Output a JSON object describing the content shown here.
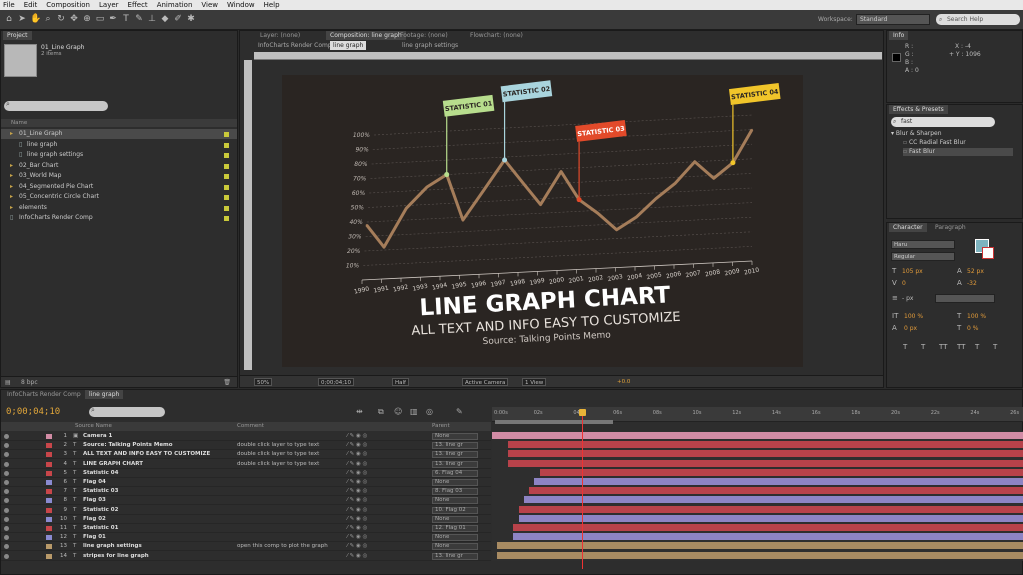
{
  "menu": [
    "File",
    "Edit",
    "Composition",
    "Layer",
    "Effect",
    "Animation",
    "View",
    "Window",
    "Help"
  ],
  "toolbar": {
    "workspace_label": "Workspace:",
    "workspace_value": "Standard",
    "search_placeholder": "Search Help"
  },
  "project": {
    "tab": "Project",
    "name": "01_Line Graph",
    "subtitle": "2 items",
    "col_name": "Name",
    "footer_bpc": "8 bpc",
    "items": [
      {
        "label": "01_Line Graph",
        "type": "folder",
        "sub": false,
        "sel": true
      },
      {
        "label": "line graph",
        "type": "comp",
        "sub": true
      },
      {
        "label": "line graph settings",
        "type": "comp",
        "sub": true
      },
      {
        "label": "02_Bar Chart",
        "type": "folder",
        "sub": false
      },
      {
        "label": "03_World Map",
        "type": "folder",
        "sub": false
      },
      {
        "label": "04_Segmented Pie Chart",
        "type": "folder",
        "sub": false
      },
      {
        "label": "05_Concentric Circle Chart",
        "type": "folder",
        "sub": false
      },
      {
        "label": "elements",
        "type": "folder",
        "sub": false
      },
      {
        "label": "InfoCharts Render Comp",
        "type": "comp",
        "sub": false
      }
    ]
  },
  "viewer": {
    "tabs": [
      "Layer: (none)",
      "Composition: line graph",
      "Footage: (none)",
      "Flowchart: (none)"
    ],
    "sub_tabs": [
      "InfoCharts Render Comp",
      "line graph",
      "line graph settings"
    ],
    "zoom": "50%",
    "timecode": "0;00;04;10",
    "resolution": "Half",
    "camera": "Active Camera",
    "views": "1 View",
    "exposure": "+0.0"
  },
  "chart_data": {
    "type": "line",
    "x": [
      "1990",
      "1991",
      "1992",
      "1993",
      "1994",
      "1995",
      "1996",
      "1997",
      "1998",
      "1999",
      "2000",
      "2001",
      "2002",
      "2003",
      "2004",
      "2005",
      "2006",
      "2007",
      "2008",
      "2009",
      "2010"
    ],
    "y_ticks": [
      "100%",
      "90%",
      "80%",
      "70%",
      "60%",
      "50%",
      "40%",
      "30%",
      "20%",
      "10%"
    ],
    "ylim": [
      0,
      100
    ],
    "series": [
      {
        "values": [
          38,
          22,
          48,
          62,
          70,
          38,
          58,
          78,
          62,
          46,
          68,
          48,
          38,
          26,
          34,
          46,
          56,
          70,
          58,
          68,
          90
        ]
      }
    ],
    "flags": [
      {
        "label": "STATISTIC 01",
        "x_index": 4,
        "color": "#b7dd8d"
      },
      {
        "label": "STATISTIC 02",
        "x_index": 7,
        "color": "#a9d4dd"
      },
      {
        "label": "STATISTIC 03",
        "x_index": 11,
        "color": "#e24a2a"
      },
      {
        "label": "STATISTIC 04",
        "x_index": 19,
        "color": "#f1c52a"
      }
    ],
    "title": "LINE GRAPH CHART",
    "subtitle": "ALL TEXT AND INFO EASY TO CUSTOMIZE",
    "source": "Source: Talking Points Memo",
    "line_color": "#a57d5a",
    "grid": true
  },
  "info": {
    "tab": "Info",
    "x": "X : -4",
    "y": "+ Y : 1096",
    "r": "R :",
    "g": "G :",
    "b": "B :",
    "a": "A : 0"
  },
  "effects": {
    "tabs": [
      "Effects & Presets"
    ],
    "search": "fast",
    "category": "Blur & Sharpen",
    "items": [
      "CC Radial Fast Blur",
      "Fast Blur"
    ]
  },
  "character": {
    "tabs": [
      "Character",
      "Paragraph"
    ],
    "font": "Haru",
    "style": "Regular",
    "size": "105 px",
    "leading": "52 px",
    "tracking": "0",
    "kerning": "-32",
    "stroke": "- px",
    "vscale": "100 %",
    "hscale": "100 %",
    "baseline": "0 px",
    "tsume": "0 %",
    "styles": [
      "T",
      "T",
      "TT",
      "TT",
      "T",
      "T"
    ]
  },
  "timeline": {
    "tabs": [
      "InfoCharts Render Comp",
      "line graph"
    ],
    "time": "0;00;04;10",
    "headers": {
      "name": "Source Name",
      "comment": "Comment",
      "parent": "Parent"
    },
    "ticks": [
      "0:00s",
      "02s",
      "04s",
      "06s",
      "08s",
      "10s",
      "12s",
      "14s",
      "16s",
      "18s",
      "20s",
      "22s",
      "24s",
      "26s"
    ],
    "layers": [
      {
        "num": "1",
        "name": "Camera 1",
        "comment": "",
        "parent": "None",
        "color": "#d28ca5"
      },
      {
        "num": "2",
        "name": "Source: Talking Points Memo",
        "comment": "double click layer to type text",
        "parent": "13. line gr",
        "color": "#c8464a"
      },
      {
        "num": "3",
        "name": "ALL TEXT AND INFO EASY TO CUSTOMIZE",
        "comment": "double click layer to type text",
        "parent": "13. line gr",
        "color": "#c8464a"
      },
      {
        "num": "4",
        "name": "LINE GRAPH CHART",
        "comment": "double click layer to type text",
        "parent": "13. line gr",
        "color": "#c8464a"
      },
      {
        "num": "5",
        "name": "Statistic 04",
        "comment": "",
        "parent": "6. Flag 04",
        "color": "#c8464a"
      },
      {
        "num": "6",
        "name": "Flag 04",
        "comment": "",
        "parent": "None",
        "color": "#8a8ad0"
      },
      {
        "num": "7",
        "name": "Statistic 03",
        "comment": "",
        "parent": "8. Flag 03",
        "color": "#c8464a"
      },
      {
        "num": "8",
        "name": "Flag 03",
        "comment": "",
        "parent": "None",
        "color": "#8a8ad0"
      },
      {
        "num": "9",
        "name": "Statistic 02",
        "comment": "",
        "parent": "10. Flag 02",
        "color": "#c8464a"
      },
      {
        "num": "10",
        "name": "Flag 02",
        "comment": "",
        "parent": "None",
        "color": "#8a8ad0"
      },
      {
        "num": "11",
        "name": "Statistic 01",
        "comment": "",
        "parent": "12. Flag 01",
        "color": "#c8464a"
      },
      {
        "num": "12",
        "name": "Flag 01",
        "comment": "",
        "parent": "None",
        "color": "#8a8ad0"
      },
      {
        "num": "13",
        "name": "line graph settings",
        "comment": "open this comp to plot the graph",
        "parent": "None",
        "color": "#b99a6a"
      },
      {
        "num": "14",
        "name": "stripes for line graph",
        "comment": "",
        "parent": "13. line gr",
        "color": "#b99a6a"
      }
    ],
    "bars": [
      {
        "start": 0.0,
        "end": 1.0,
        "color": "#d28ca5"
      },
      {
        "start": 0.03,
        "end": 1.0,
        "color": "#b8424a"
      },
      {
        "start": 0.03,
        "end": 1.0,
        "color": "#b8424a"
      },
      {
        "start": 0.03,
        "end": 1.0,
        "color": "#b8424a"
      },
      {
        "start": 0.09,
        "end": 1.0,
        "color": "#b8424a"
      },
      {
        "start": 0.08,
        "end": 1.0,
        "color": "#8d84c4"
      },
      {
        "start": 0.07,
        "end": 1.0,
        "color": "#b8424a"
      },
      {
        "start": 0.06,
        "end": 1.0,
        "color": "#8d84c4"
      },
      {
        "start": 0.05,
        "end": 1.0,
        "color": "#b8424a"
      },
      {
        "start": 0.05,
        "end": 1.0,
        "color": "#8d84c4"
      },
      {
        "start": 0.04,
        "end": 1.0,
        "color": "#b8424a"
      },
      {
        "start": 0.04,
        "end": 1.0,
        "color": "#8d84c4"
      },
      {
        "start": 0.01,
        "end": 1.0,
        "color": "#a88b62"
      },
      {
        "start": 0.01,
        "end": 1.0,
        "color": "#a88b62"
      }
    ],
    "playhead": 0.17
  }
}
